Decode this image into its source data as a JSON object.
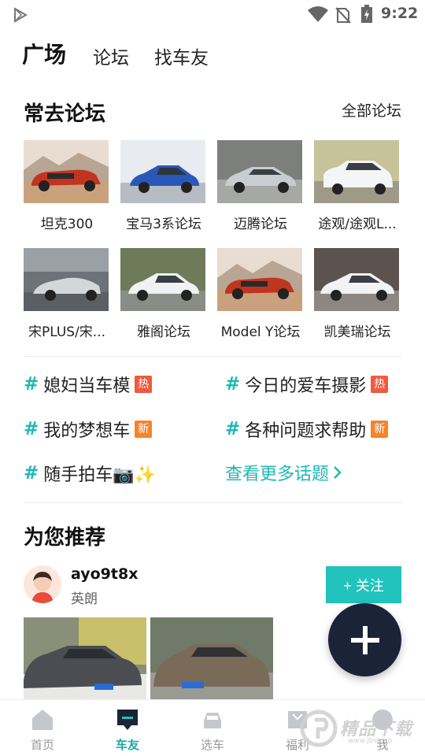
{
  "status_bar": {
    "time": "9:22"
  },
  "top_tabs": [
    "广场",
    "论坛",
    "找车友"
  ],
  "frequent": {
    "title": "常去论坛",
    "all_link": "全部论坛",
    "forums": [
      {
        "label": "坦克300",
        "car": "red-muscle-car"
      },
      {
        "label": "宝马3系论坛",
        "car": "blue-sedan"
      },
      {
        "label": "迈腾论坛",
        "car": "silver-sedan"
      },
      {
        "label": "途观/途观L...",
        "car": "white-suv"
      },
      {
        "label": "宋PLUS/宋...",
        "car": "silver-roadster"
      },
      {
        "label": "雅阁论坛",
        "car": "white-sedan"
      },
      {
        "label": "Model Y论坛",
        "car": "red-muscle-car"
      },
      {
        "label": "凯美瑞论坛",
        "car": "white-sedan"
      }
    ]
  },
  "topics": [
    {
      "text": "媳妇当车模",
      "badge": "热"
    },
    {
      "text": "今日的爱车摄影",
      "badge": "热"
    },
    {
      "text": "我的梦想车",
      "badge": "新"
    },
    {
      "text": "各种问题求帮助",
      "badge": "新"
    },
    {
      "text": "随手拍车📷✨",
      "badge": ""
    }
  ],
  "more_topics": "查看更多话题",
  "recommend": {
    "title": "为您推荐",
    "username": "ayo9t8x",
    "car": "英朗",
    "follow": "+ 关注"
  },
  "bottom_nav": [
    "首页",
    "车友",
    "选车",
    "福利",
    "我"
  ],
  "watermark": {
    "text": "精品下载",
    "url": "www.jbsmco"
  },
  "colors": {
    "accent": "#22c2bd",
    "hot": "#f05a3e",
    "new": "#f5842d",
    "fab": "#1b2338"
  }
}
